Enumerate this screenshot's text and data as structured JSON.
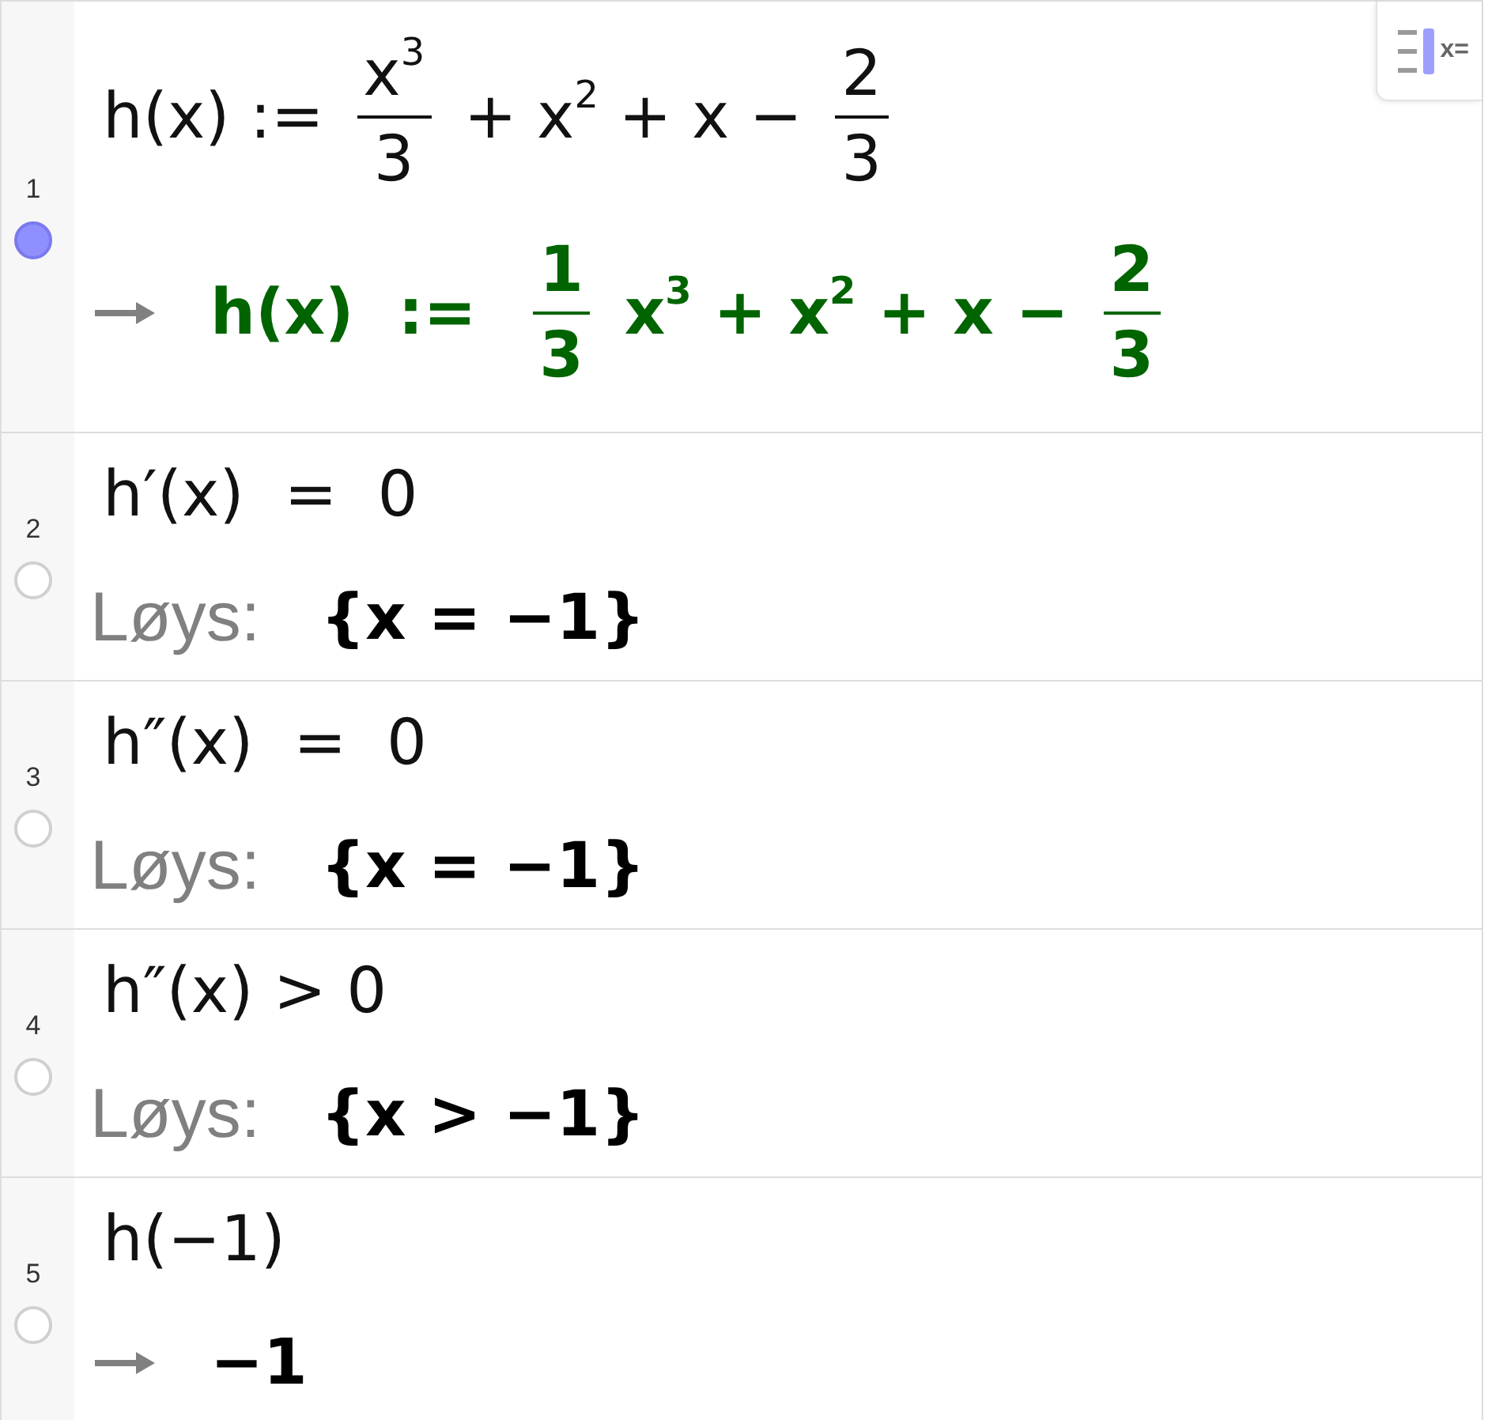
{
  "toggle_button": {
    "label": "x="
  },
  "rows": [
    {
      "number": "1",
      "shown": true,
      "input": [
        {
          "kind": "text",
          "text": "h(x) := "
        },
        {
          "kind": "frac",
          "num": "x$^{3}$",
          "den": "3"
        },
        {
          "kind": "text",
          "text": " + x$^{2}$ + x − "
        },
        {
          "kind": "frac",
          "num": "2",
          "den": "3"
        }
      ],
      "output": {
        "kind": "arrow",
        "color": "#006400",
        "value": [
          {
            "kind": "text",
            "text": "h(x)  :=  "
          },
          {
            "kind": "frac",
            "num": "1",
            "den": "3"
          },
          {
            "kind": "text",
            "text": " x$^{3}$ + x$^{2}$ + x − "
          },
          {
            "kind": "frac",
            "num": "2",
            "den": "3"
          }
        ]
      }
    },
    {
      "number": "2",
      "shown": false,
      "input": [
        {
          "kind": "text",
          "text": "h′(x)  =  0"
        }
      ],
      "output": {
        "kind": "solve",
        "label": "Løys:",
        "color": "#000000",
        "value": [
          {
            "kind": "text",
            "text": "{x = −1}"
          }
        ]
      }
    },
    {
      "number": "3",
      "shown": false,
      "input": [
        {
          "kind": "text",
          "text": "h″(x)  =  0"
        }
      ],
      "output": {
        "kind": "solve",
        "label": "Løys:",
        "color": "#000000",
        "value": [
          {
            "kind": "text",
            "text": "{x = −1}"
          }
        ]
      }
    },
    {
      "number": "4",
      "shown": false,
      "input": [
        {
          "kind": "text",
          "text": "h″(x) > 0"
        }
      ],
      "output": {
        "kind": "solve",
        "label": "Løys:",
        "color": "#000000",
        "value": [
          {
            "kind": "text",
            "text": "{x > −1}"
          }
        ]
      }
    },
    {
      "number": "5",
      "shown": false,
      "input": [
        {
          "kind": "text",
          "text": "h(−1)"
        }
      ],
      "output": {
        "kind": "arrow",
        "color": "#000000",
        "value": [
          {
            "kind": "text",
            "text": "−1"
          }
        ]
      }
    }
  ]
}
